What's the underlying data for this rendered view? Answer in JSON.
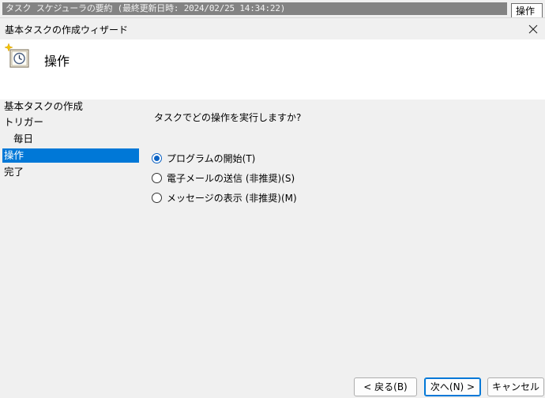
{
  "background_window": {
    "title": "タスク スケジューラの要約 (最終更新日時: 2024/02/25 14:34:22)",
    "action_tab": "操作"
  },
  "wizard": {
    "title": "基本タスクの作成ウィザード",
    "close_icon": "close-icon",
    "header_icon": "task-clock-icon",
    "header_title": "操作"
  },
  "nav": {
    "items": [
      {
        "label": "基本タスクの作成",
        "active": false
      },
      {
        "label": "トリガー",
        "active": false
      },
      {
        "label": "毎日",
        "active": false,
        "sub": true
      },
      {
        "label": "操作",
        "active": true
      },
      {
        "label": "完了",
        "active": false
      }
    ]
  },
  "content": {
    "question": "タスクでどの操作を実行しますか?",
    "options": [
      {
        "label": "プログラムの開始(T)",
        "checked": true
      },
      {
        "label": "電子メールの送信 (非推奨)(S)",
        "checked": false
      },
      {
        "label": "メッセージの表示 (非推奨)(M)",
        "checked": false
      }
    ]
  },
  "buttons": {
    "back": "< 戻る(B)",
    "next": "次へ(N) >",
    "cancel": "キャンセル"
  },
  "colors": {
    "accent": "#0078d7",
    "radio_selected": "#0b62c4"
  }
}
